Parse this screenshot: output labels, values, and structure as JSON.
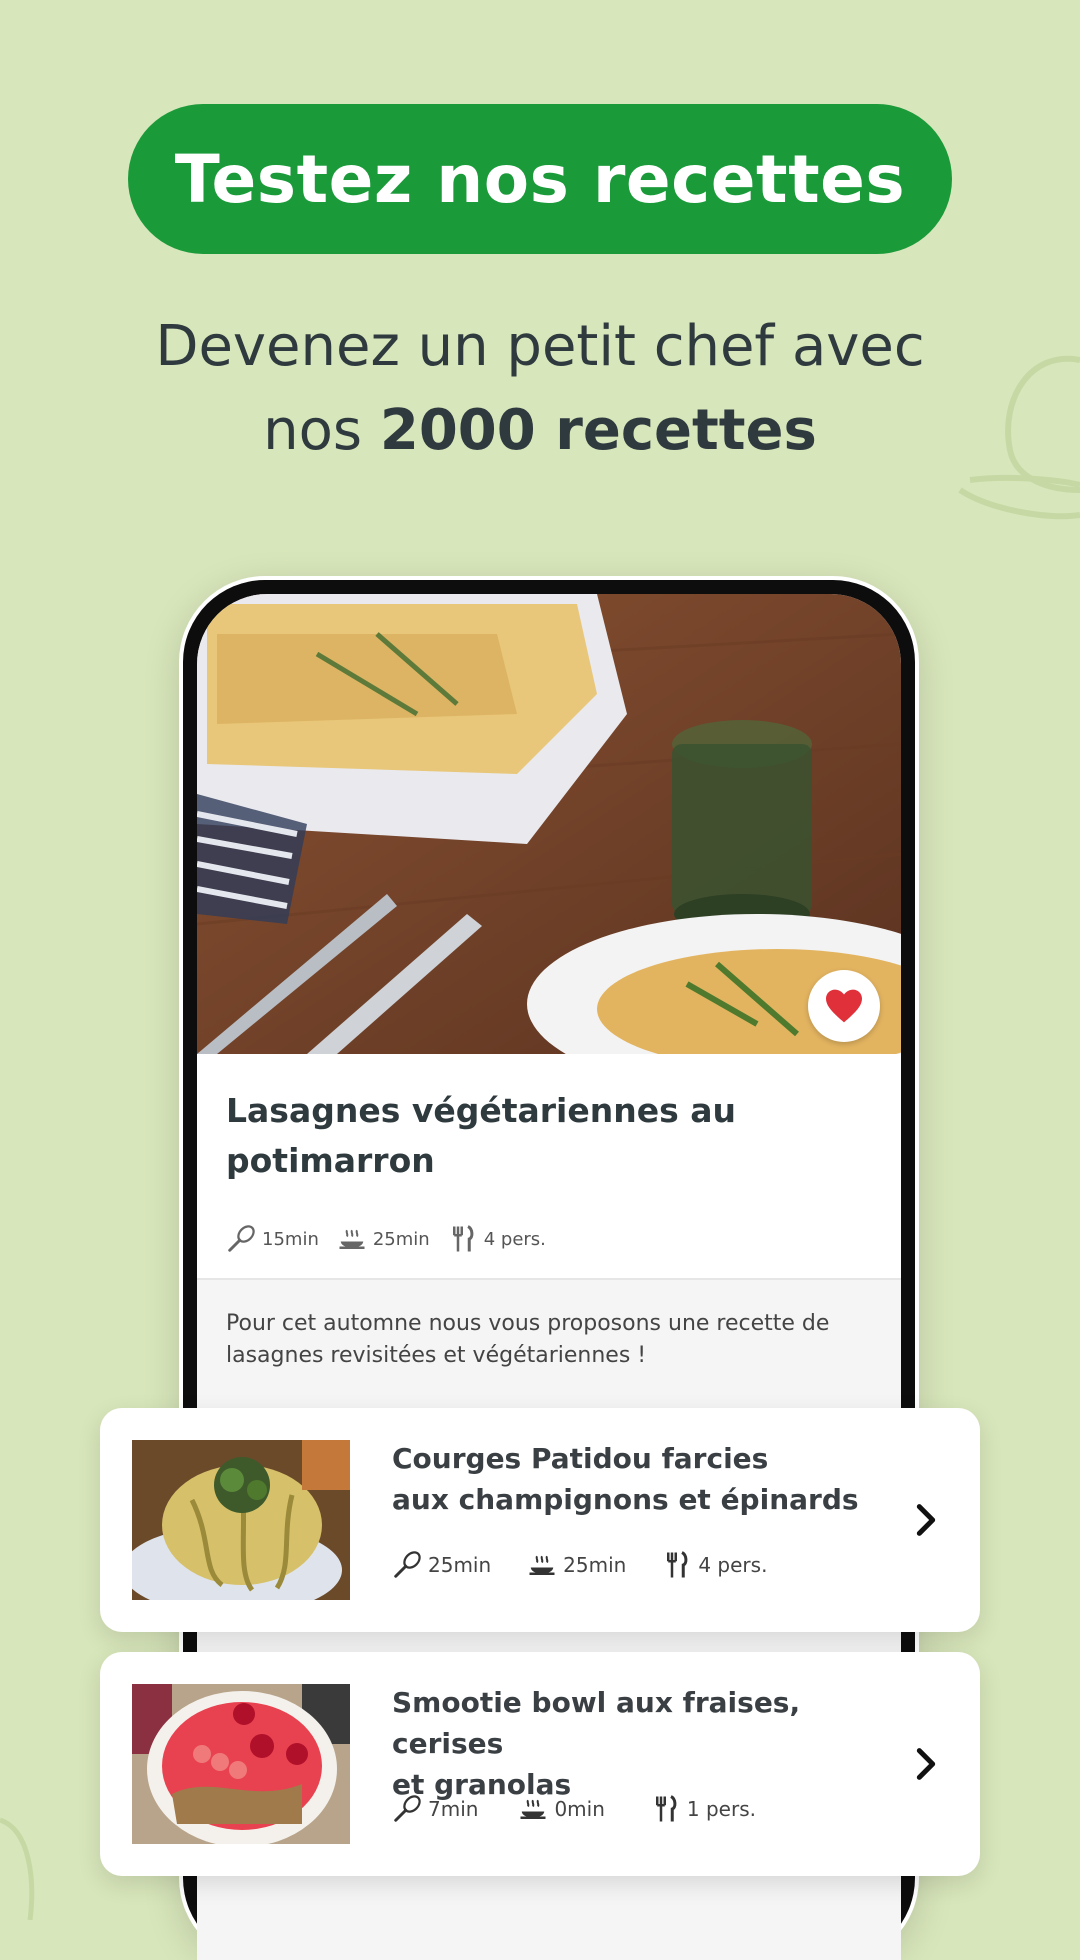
{
  "header": {
    "button_label": "Testez nos recettes",
    "subtitle_line1": "Devenez un petit chef avec",
    "subtitle_line2_prefix": "nos",
    "subtitle_line2_bold": "2000 recettes"
  },
  "featured": {
    "title_line1": "Lasagnes végétariennes au",
    "title_line2": "potimarron",
    "prep": "15min",
    "cook": "25min",
    "servings": "4 pers.",
    "description_line1": "Pour cet automne nous vous proposons une recette de",
    "description_line2": "lasagnes revisitées et végétariennes !",
    "favorite_icon": "heart-icon",
    "favorite_color": "#e0303a"
  },
  "recipes": [
    {
      "title_line1": "Courges Patidou farcies",
      "title_line2": "aux champignons et épinards",
      "prep": "25min",
      "cook": "25min",
      "servings": "4 pers."
    },
    {
      "title_line1": "Smootie bowl aux fraises, cerises",
      "title_line2": "et granolas",
      "prep": "7min",
      "cook": "0min",
      "servings": "1 pers."
    }
  ],
  "colors": {
    "background": "#d8e6bb",
    "accent_green": "#1b9a3a",
    "text_dark": "#2f3a3f"
  }
}
